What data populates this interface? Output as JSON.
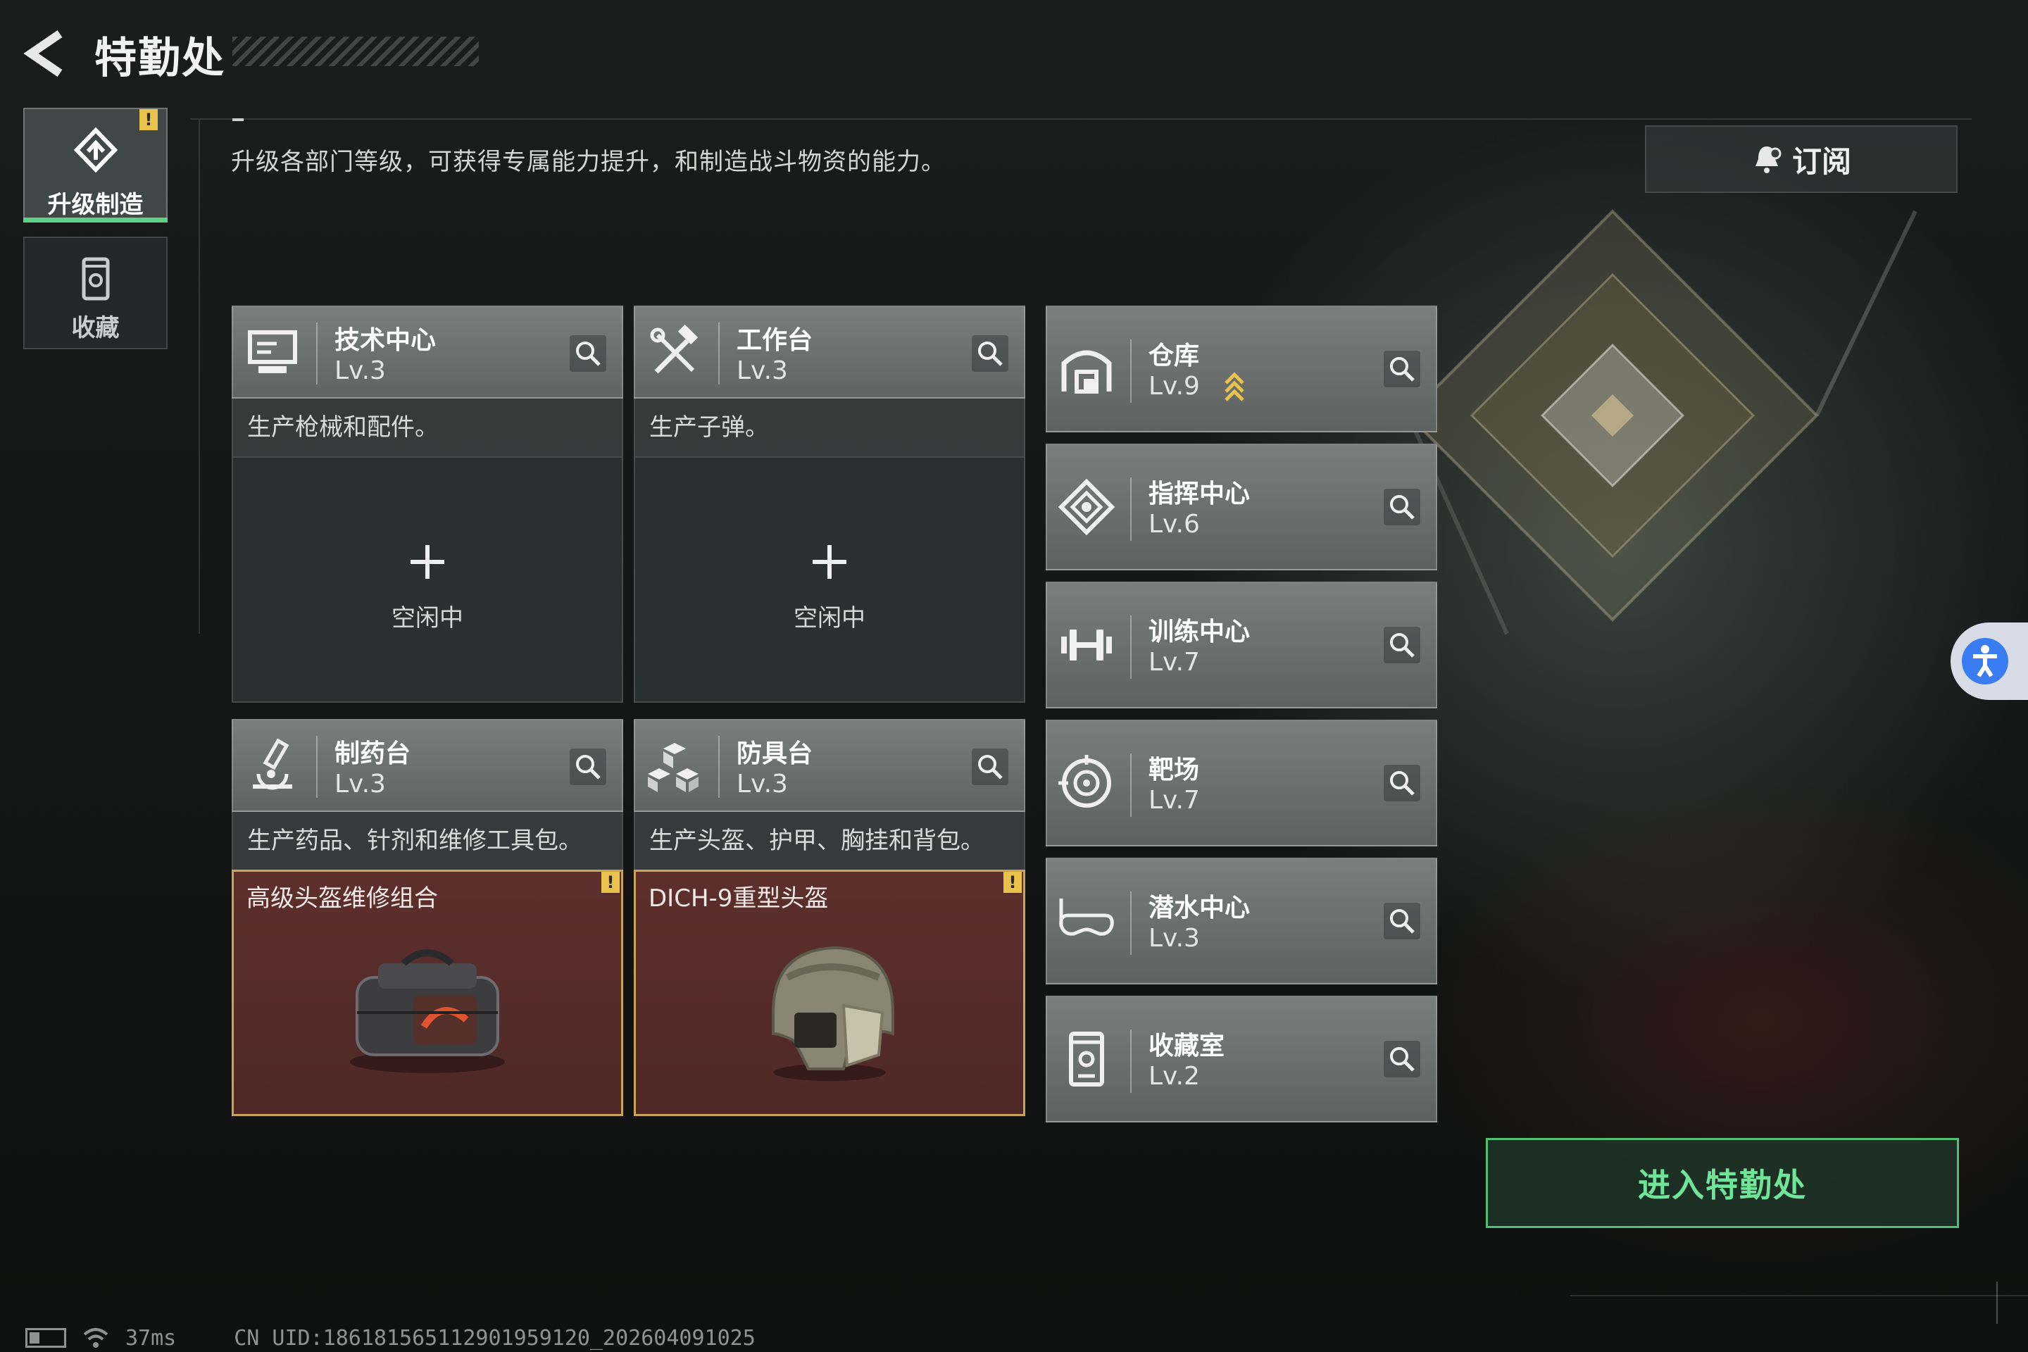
{
  "header": {
    "title": "特勤处",
    "subtitle": "升级各部门等级，可获得专属能力提升，和制造战斗物资的能力。",
    "subscribe_label": "订阅"
  },
  "side_tabs": [
    {
      "label": "升级制造",
      "icon": "upgrade-icon",
      "active": true,
      "has_notice": true
    },
    {
      "label": "收藏",
      "icon": "collection-icon",
      "active": false,
      "has_notice": false
    }
  ],
  "notice_mark": "!",
  "production": [
    {
      "name": "技术中心",
      "level": "Lv.3",
      "desc": "生产枪械和配件。",
      "icon": "computer-icon",
      "status": "空闲中"
    },
    {
      "name": "工作台",
      "level": "Lv.3",
      "desc": "生产子弹。",
      "icon": "tools-icon",
      "status": "空闲中"
    },
    {
      "name": "制药台",
      "level": "Lv.3",
      "desc": "生产药品、针剂和维修工具包。",
      "icon": "microscope-icon",
      "item": "高级头盔维修组合"
    },
    {
      "name": "防具台",
      "level": "Lv.3",
      "desc": "生产头盔、护甲、胸挂和背包。",
      "icon": "armor-blocks-icon",
      "item": "DICH-9重型头盔"
    }
  ],
  "facilities": [
    {
      "name": "仓库",
      "level": "Lv.9",
      "icon": "warehouse-icon",
      "upgradable": true
    },
    {
      "name": "指挥中心",
      "level": "Lv.6",
      "icon": "command-icon",
      "upgradable": false
    },
    {
      "name": "训练中心",
      "level": "Lv.7",
      "icon": "dumbbell-icon",
      "upgradable": false
    },
    {
      "name": "靶场",
      "level": "Lv.7",
      "icon": "target-icon",
      "upgradable": false
    },
    {
      "name": "潜水中心",
      "level": "Lv.3",
      "icon": "diving-mask-icon",
      "upgradable": false
    },
    {
      "name": "收藏室",
      "level": "Lv.2",
      "icon": "collection-room-icon",
      "upgradable": false
    }
  ],
  "enter_button": "进入特勤处",
  "status": {
    "ping": "37ms",
    "uid": "CN UID:18618156511290195912​0_202604091025"
  },
  "colors": {
    "accent_green": "#5fd08a",
    "notice_yellow": "#e8c24a",
    "item_border": "#c9a456",
    "accessibility_blue": "#3a7df2"
  }
}
